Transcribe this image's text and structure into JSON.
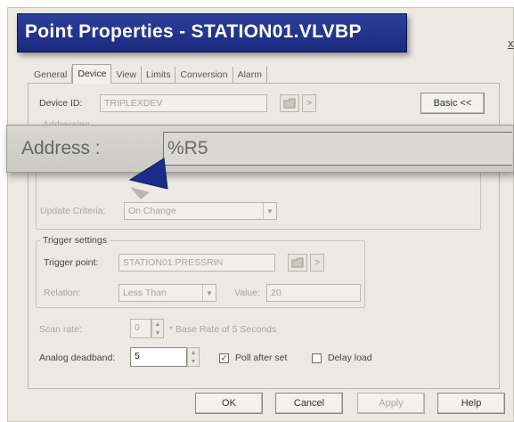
{
  "dialog": {
    "title": "Point Properties - STATION01.VLVBP",
    "close_glyph": "x"
  },
  "tabs": [
    "General",
    "Device",
    "View",
    "Limits",
    "Conversion",
    "Alarm"
  ],
  "active_tab": "Device",
  "device": {
    "label": "Device ID:",
    "value": "TRIPLEXDEV",
    "browse_icon": "folder-icon",
    "goto_glyph": ">",
    "basic_button": "Basic <<"
  },
  "addressing": {
    "group_label": "Addressing",
    "address_label": "Address :",
    "address_value": "%R5",
    "update_criteria_label": "Update Criteria:",
    "update_criteria_value": "On Change"
  },
  "trigger": {
    "group_label": "Trigger settings",
    "point_label": "Trigger point:",
    "point_value": "STATION01.PRESSRIN",
    "browse_icon": "folder-icon",
    "goto_glyph": ">",
    "relation_label": "Relation:",
    "relation_value": "Less Than",
    "value_label": "Value:",
    "value_value": "20"
  },
  "scan": {
    "label": "Scan rate:",
    "value": "0",
    "note": "* Base Rate of 5 Seconds"
  },
  "deadband": {
    "label": "Analog deadband:",
    "value": "5"
  },
  "options": {
    "poll_after_set_label": "Poll after set",
    "poll_after_set_checked": true,
    "delay_load_label": "Delay load",
    "delay_load_checked": false,
    "check_glyph": "✓"
  },
  "buttons": {
    "ok": "OK",
    "cancel": "Cancel",
    "apply": "Apply",
    "help": "Help"
  },
  "colors": {
    "title_bar": "#1b2a7e",
    "pointer": "#1c2c8c"
  }
}
